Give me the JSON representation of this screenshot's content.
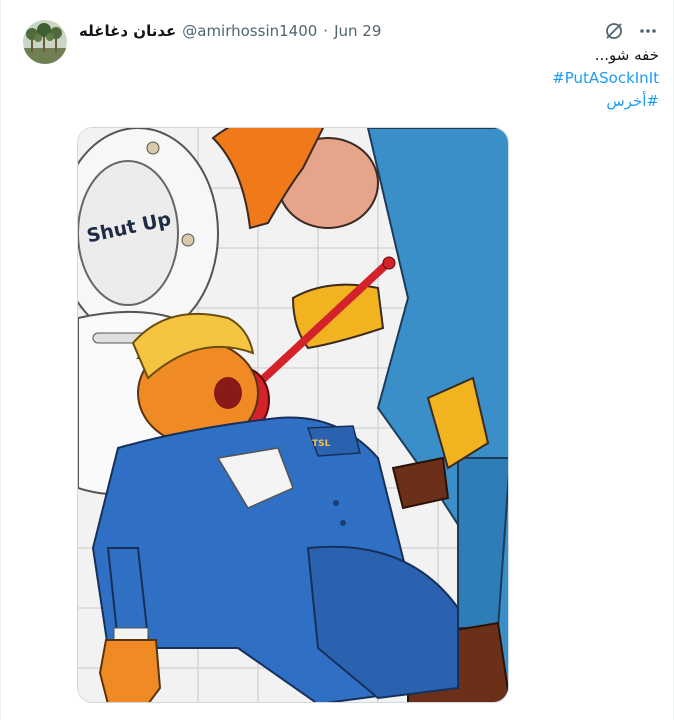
{
  "tweet": {
    "display_name": "عدنان دغاغله",
    "handle": "@amirhossin1400",
    "separator": "·",
    "date": "Jun 29",
    "text": "خفه شو...",
    "hashtags": [
      "#PutASockInIt",
      "#أخرس"
    ],
    "avatar_icon": "avatar-palm-trees",
    "top_icons": [
      "grok-icon",
      "more-icon"
    ]
  },
  "media": {
    "kind": "cartoon-illustration",
    "seat_text": "Shut Up",
    "pocket_text": "TSL",
    "colors": {
      "suit": "#2f6fc4",
      "worker": "#3a8fc8",
      "helmet": "#f07a1a",
      "plunger": "#d3222a",
      "glove": "#f2b320",
      "hair": "#f5c542",
      "skin": "#f08a24",
      "tile": "#f2f2f2"
    }
  },
  "colors": {
    "link": "#1d9bf0",
    "text": "#0f1419",
    "secondary": "#536471"
  }
}
